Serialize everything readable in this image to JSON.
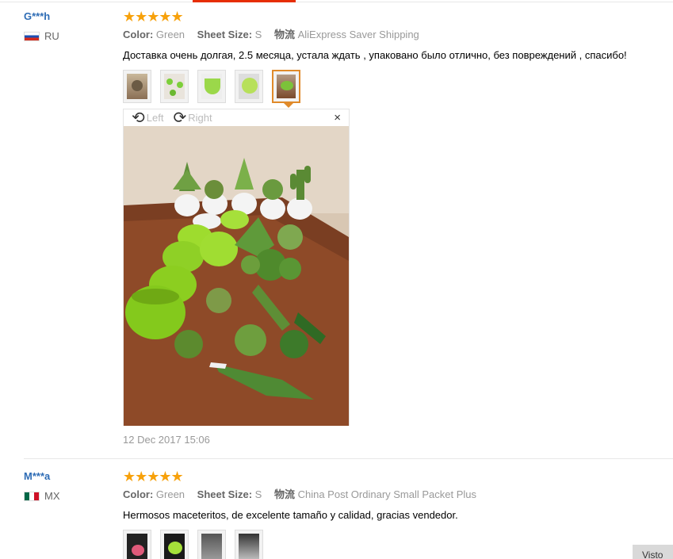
{
  "reviews": [
    {
      "user": "G***h",
      "country": "RU",
      "stars": "★★★★★",
      "color_label": "Color:",
      "color_value": "Green",
      "size_label": "Sheet Size:",
      "size_value": "S",
      "logistics_label": "物流",
      "logistics_value": "AliExpress Saver Shipping",
      "feedback": "Доставка очень долгая, 2.5 месяца, устала ждать , упаковано было отлично, без повреждений , спасибо!",
      "date": "12 Dec 2017 15:06"
    },
    {
      "user": "M***a",
      "country": "MX",
      "stars": "★★★★★",
      "color_label": "Color:",
      "color_value": "Green",
      "size_label": "Sheet Size:",
      "size_value": "S",
      "logistics_label": "物流",
      "logistics_value": "China Post Ordinary Small Packet Plus",
      "feedback": "Hermosos maceteritos, de excelente tamaño y calidad, gracias vendedor."
    }
  ],
  "viewer": {
    "rotate_left": "Left",
    "rotate_right": "Right",
    "close": "×"
  },
  "corner_button": "Visto",
  "colors": {
    "accent": "#e62e04",
    "username": "#2e6cb5",
    "stars": "#f7a10b",
    "active_thumb": "#e08a2a"
  }
}
